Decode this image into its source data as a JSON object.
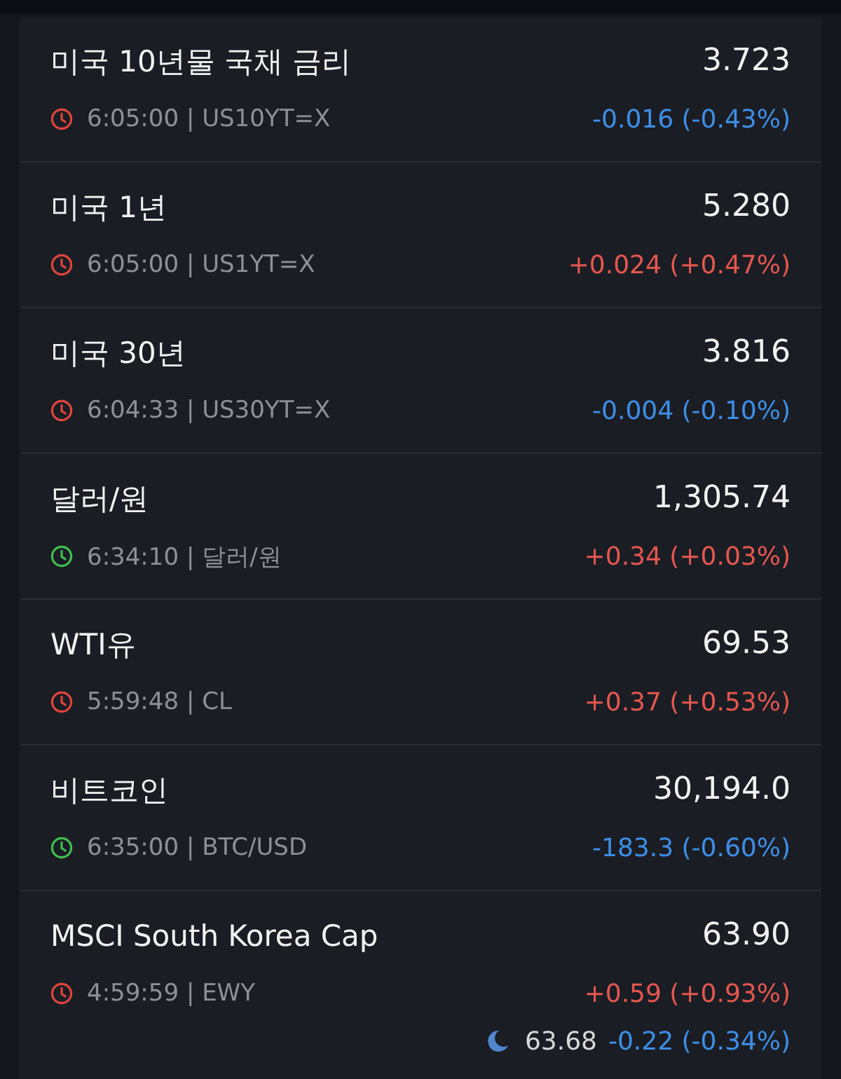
{
  "quotes": [
    {
      "name": "미국 10년물 국채 금리",
      "price": "3.723",
      "meta": "6:05:00 | US10YT=X",
      "change": {
        "text": "-0.016 (-0.43%)",
        "color": "#3d8fe8"
      },
      "color": "#e0453c"
    },
    {
      "name": "미국 1년",
      "price": "5.280",
      "meta": "6:05:00 | US1YT=X",
      "change": {
        "text": "+0.024 (+0.47%)",
        "color": "#e5574f"
      },
      "color": "#e0453c"
    },
    {
      "name": "미국 30년",
      "price": "3.816",
      "meta": "6:04:33 | US30YT=X",
      "change": {
        "text": "-0.004 (-0.10%)",
        "color": "#3d8fe8"
      },
      "color": "#e0453c"
    },
    {
      "name": "달러/원",
      "price": "1,305.74",
      "meta": "6:34:10 | 달러/원",
      "change": {
        "text": "+0.34 (+0.03%)",
        "color": "#e5574f"
      },
      "color": "#3fbf4f"
    },
    {
      "name": "WTI유",
      "price": "69.53",
      "meta": "5:59:48 | CL",
      "change": {
        "text": "+0.37 (+0.53%)",
        "color": "#e5574f"
      },
      "color": "#e0453c"
    },
    {
      "name": "비트코인",
      "price": "30,194.0",
      "meta": "6:35:00 | BTC/USD",
      "change": {
        "text": "-183.3 (-0.60%)",
        "color": "#3d8fe8"
      },
      "color": "#3fbf4f"
    },
    {
      "name": "MSCI South Korea Cap",
      "price": "63.90",
      "meta": "4:59:59 | EWY",
      "change": {
        "text": "+0.59 (+0.93%)",
        "color": "#e5574f"
      },
      "color": "#e0453c",
      "after_hours": {
        "price": "63.68",
        "change": {
          "text": "-0.22 (-0.34%)",
          "color": "#3d8fe8"
        }
      }
    }
  ]
}
